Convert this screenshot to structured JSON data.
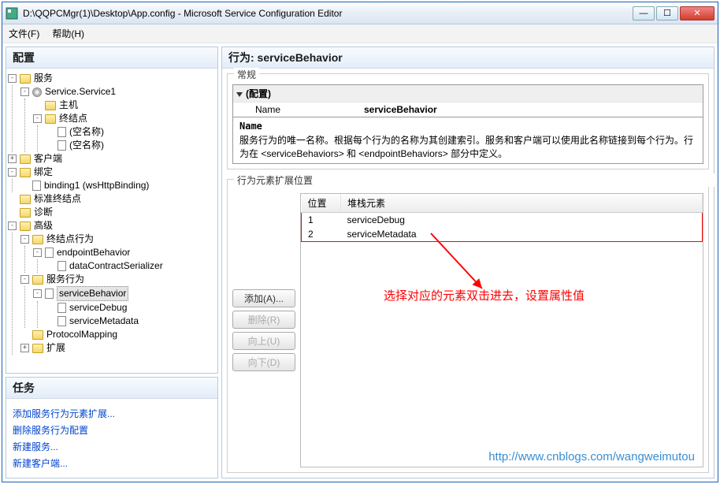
{
  "window": {
    "title": "D:\\QQPCMgr(1)\\Desktop\\App.config - Microsoft Service Configuration Editor"
  },
  "menu": {
    "file": "文件(F)",
    "help": "帮助(H)"
  },
  "leftPanel": {
    "configHeader": "配置",
    "tree": {
      "services": "服务",
      "service1": "Service.Service1",
      "host": "主机",
      "endpoints": "终结点",
      "epEmpty": "(空名称)",
      "client": "客户端",
      "binding": "绑定",
      "binding1": "binding1 (wsHttpBinding)",
      "stdEndpoints": "标准终结点",
      "diagnose": "诊断",
      "advanced": "高级",
      "epBehavior": "终结点行为",
      "epBehaviorItem": "endpointBehavior",
      "dataContract": "dataContractSerializer",
      "svcBehavior": "服务行为",
      "svcBehaviorItem": "serviceBehavior",
      "svcDebug": "serviceDebug",
      "svcMetadata": "serviceMetadata",
      "protocolMapping": "ProtocolMapping",
      "extensions": "扩展"
    },
    "tasksHeader": "任务",
    "tasks": {
      "t1": "添加服务行为元素扩展...",
      "t2": "删除服务行为配置",
      "t3": "新建服务...",
      "t4": "新建客户端..."
    }
  },
  "rightPanel": {
    "header": "行为: serviceBehavior",
    "generalGroup": "常规",
    "propCategory": "(配置)",
    "propNameLabel": "Name",
    "propNameValue": "serviceBehavior",
    "descTitle": "Name",
    "descText": "服务行为的唯一名称。根据每个行为的名称为其创建索引。服务和客户端可以使用此名称链接到每个行为。行为在 <serviceBehaviors> 和 <endpointBehaviors> 部分中定义。",
    "extGroup": "行为元素扩展位置",
    "buttons": {
      "add": "添加(A)...",
      "del": "删除(R)",
      "up": "向上(U)",
      "down": "向下(D)"
    },
    "tableHeaders": {
      "pos": "位置",
      "stack": "堆栈元素"
    },
    "rows": [
      {
        "pos": "1",
        "name": "serviceDebug"
      },
      {
        "pos": "2",
        "name": "serviceMetadata"
      }
    ],
    "annotation": "选择对应的元素双击进去，设置属性值",
    "watermark": "http://www.cnblogs.com/wangweimutou"
  }
}
